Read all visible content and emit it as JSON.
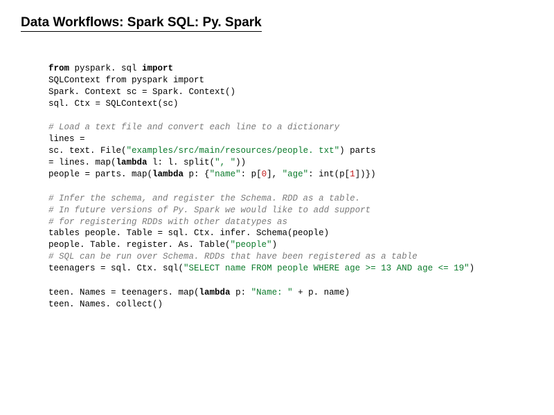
{
  "title": "Data Workflows: Spark SQL: Py. Spark",
  "b1": {
    "l1a": "from",
    "l1b": " pyspark. sql ",
    "l1c": "import",
    "l2": "SQLContext from pyspark import",
    "l3": "Spark. Context sc = Spark. Context()",
    "l4": "sql. Ctx = SQLContext(sc)"
  },
  "b2": {
    "c1": "# Load a text file and convert each line to a dictionary",
    "l1": "lines =",
    "l2a": "sc. text. File(",
    "l2b": "\"examples/src/main/resources/people. txt\"",
    "l2c": ") parts",
    "l3a": "= lines. map(",
    "l3b": "lambda",
    "l3c": " l: l. split(",
    "l3d": "\", \"",
    "l3e": "))",
    "l4a": "people = parts. map(",
    "l4b": "lambda",
    "l4c": " p: {",
    "l4d": "\"name\"",
    "l4e": ": p[",
    "l4f": "0",
    "l4g": "], ",
    "l4h": "\"age\"",
    "l4i": ": int(p[",
    "l4j": "1",
    "l4k": "])})"
  },
  "b3": {
    "c1": "# Infer the schema, and register the Schema. RDD as a table.",
    "c2": "# In future versions of Py. Spark we would like to add support",
    "c3": "# for registering RDDs with other datatypes as",
    "l1": "tables people. Table = sql. Ctx. infer. Schema(people)",
    "l2a": "people. Table. register. As. Table(",
    "l2b": "\"people\"",
    "l2c": ")",
    "c4": "# SQL can be run over Schema. RDDs that have been registered as a table",
    "l3a": "teenagers = sql. Ctx. sql(",
    "l3b": "\"SELECT name FROM people WHERE age >= 13 AND age <= 19\"",
    "l3c": ")"
  },
  "b4": {
    "l1a": "teen. Names = teenagers. map(",
    "l1b": "lambda",
    "l1c": " p: ",
    "l1d": "\"Name: \"",
    "l1e": " + p. name)",
    "l2": "teen. Names. collect()"
  }
}
